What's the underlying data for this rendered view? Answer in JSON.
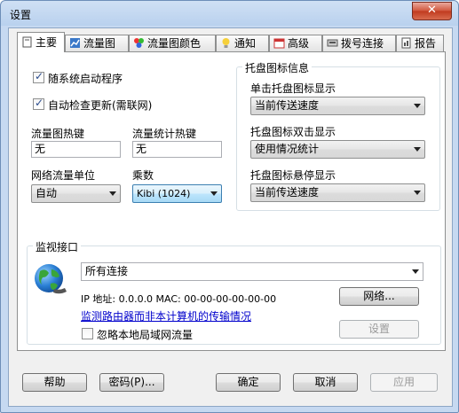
{
  "window": {
    "title": "设置",
    "close_glyph": "✕"
  },
  "tabs": [
    {
      "label": "主要",
      "icon": "page-icon"
    },
    {
      "label": "流量图",
      "icon": "chart-icon"
    },
    {
      "label": "流量图颜色",
      "icon": "palette-icon"
    },
    {
      "label": "通知",
      "icon": "bulb-icon"
    },
    {
      "label": "高级",
      "icon": "calendar-icon"
    },
    {
      "label": "拨号连接",
      "icon": "modem-icon"
    },
    {
      "label": "报告",
      "icon": "report-icon"
    }
  ],
  "main": {
    "autostart_label": "随系统启动程序",
    "autostart_checked": true,
    "autoupdate_label": "自动检查更新(需联网)",
    "autoupdate_checked": true,
    "graph_hotkey_label": "流量图热键",
    "graph_hotkey_value": "无",
    "stats_hotkey_label": "流量统计热键",
    "stats_hotkey_value": "无",
    "unit_label": "网络流量单位",
    "unit_value": "自动",
    "multiplier_label": "乘数",
    "multiplier_value": "Kibi (1024)"
  },
  "tray": {
    "group_title": "托盘图标信息",
    "click_label": "单击托盘图标显示",
    "click_value": "当前传送速度",
    "dblclick_label": "托盘图标双击显示",
    "dblclick_value": "使用情况统计",
    "hover_label": "托盘图标悬停显示",
    "hover_value": "当前传送速度"
  },
  "monitor": {
    "group_title": "监视接口",
    "interface_value": "所有连接",
    "ip_text": "IP 地址: 0.0.0.0   MAC: 00-00-00-00-00-00",
    "network_button": "网络...",
    "router_link": "监测路由器而非本计算机的传输情况",
    "ignore_lan_label": "忽略本地局域网流量",
    "ignore_lan_checked": false,
    "settings_button": "设置"
  },
  "footer": {
    "help": "帮助",
    "password": "密码(P)...",
    "ok": "确定",
    "cancel": "取消",
    "apply": "应用"
  }
}
